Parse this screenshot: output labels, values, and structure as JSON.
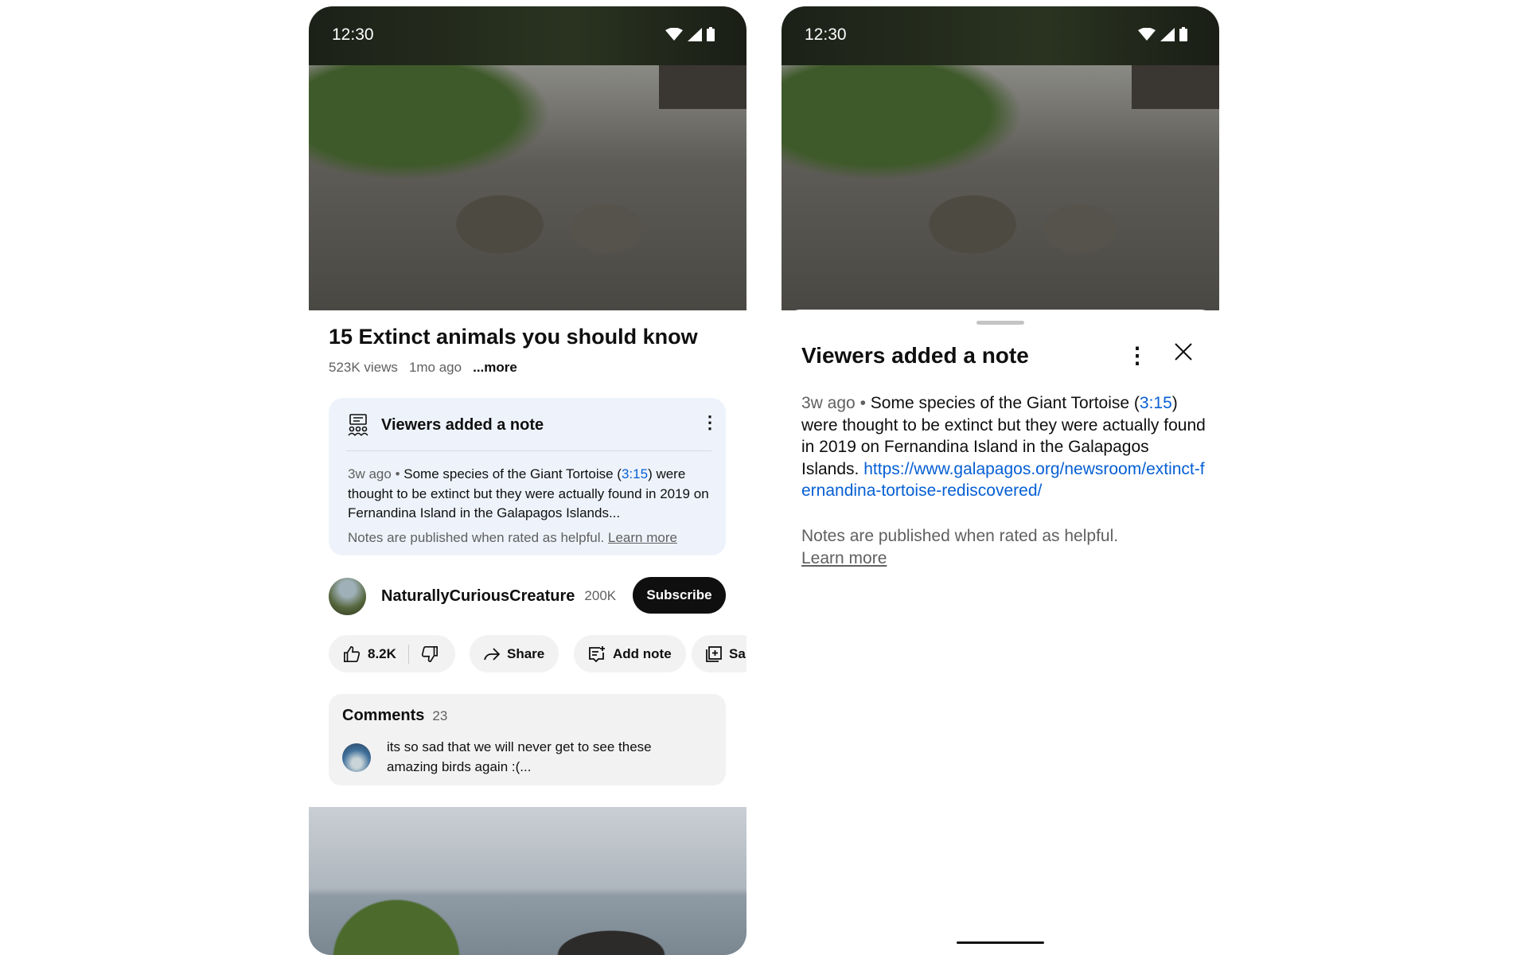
{
  "status": {
    "time": "12:30"
  },
  "video": {
    "title": "15 Extinct animals you should know",
    "views": "523K views",
    "age": "1mo ago",
    "more": "...more"
  },
  "note_card": {
    "header": "Viewers added a note",
    "age": "3w ago",
    "bullet": "•",
    "text_before": "Some species of the Giant Tortoise (",
    "timestamp": "3:15",
    "text_after": ") were thought to be extinct but they were actually found in 2019 on Fernandina Island in the Galapagos Islands...",
    "footer": "Notes are published when rated as helpful.",
    "learn_more": "Learn more"
  },
  "channel": {
    "name": "NaturallyCuriousCreature",
    "subscribers": "200K",
    "subscribe_label": "Subscribe"
  },
  "actions": {
    "likes": "8.2K",
    "share": "Share",
    "add_note": "Add note",
    "save": "Sa"
  },
  "comments": {
    "label": "Comments",
    "count": "23",
    "top_comment": "its so sad that we will never get to see these amazing birds again :(..."
  },
  "sheet": {
    "title": "Viewers added a note",
    "age": "3w ago",
    "bullet": "•",
    "text_before": "Some species of the Giant Tortoise (",
    "timestamp": "3:15",
    "text_after": ") were thought to be extinct but they were actually found in 2019 on Fernandina Island in the Galapagos Islands.",
    "url": "https://www.galapagos.org/newsroom/extinct-fernandina-tortoise-rediscovered/",
    "footer": "Notes are published when rated as helpful.",
    "learn_more": "Learn more"
  },
  "colors": {
    "link": "#065fd4",
    "note_bg": "#eef3fb",
    "subscribe_bg": "#0f0f0f"
  }
}
